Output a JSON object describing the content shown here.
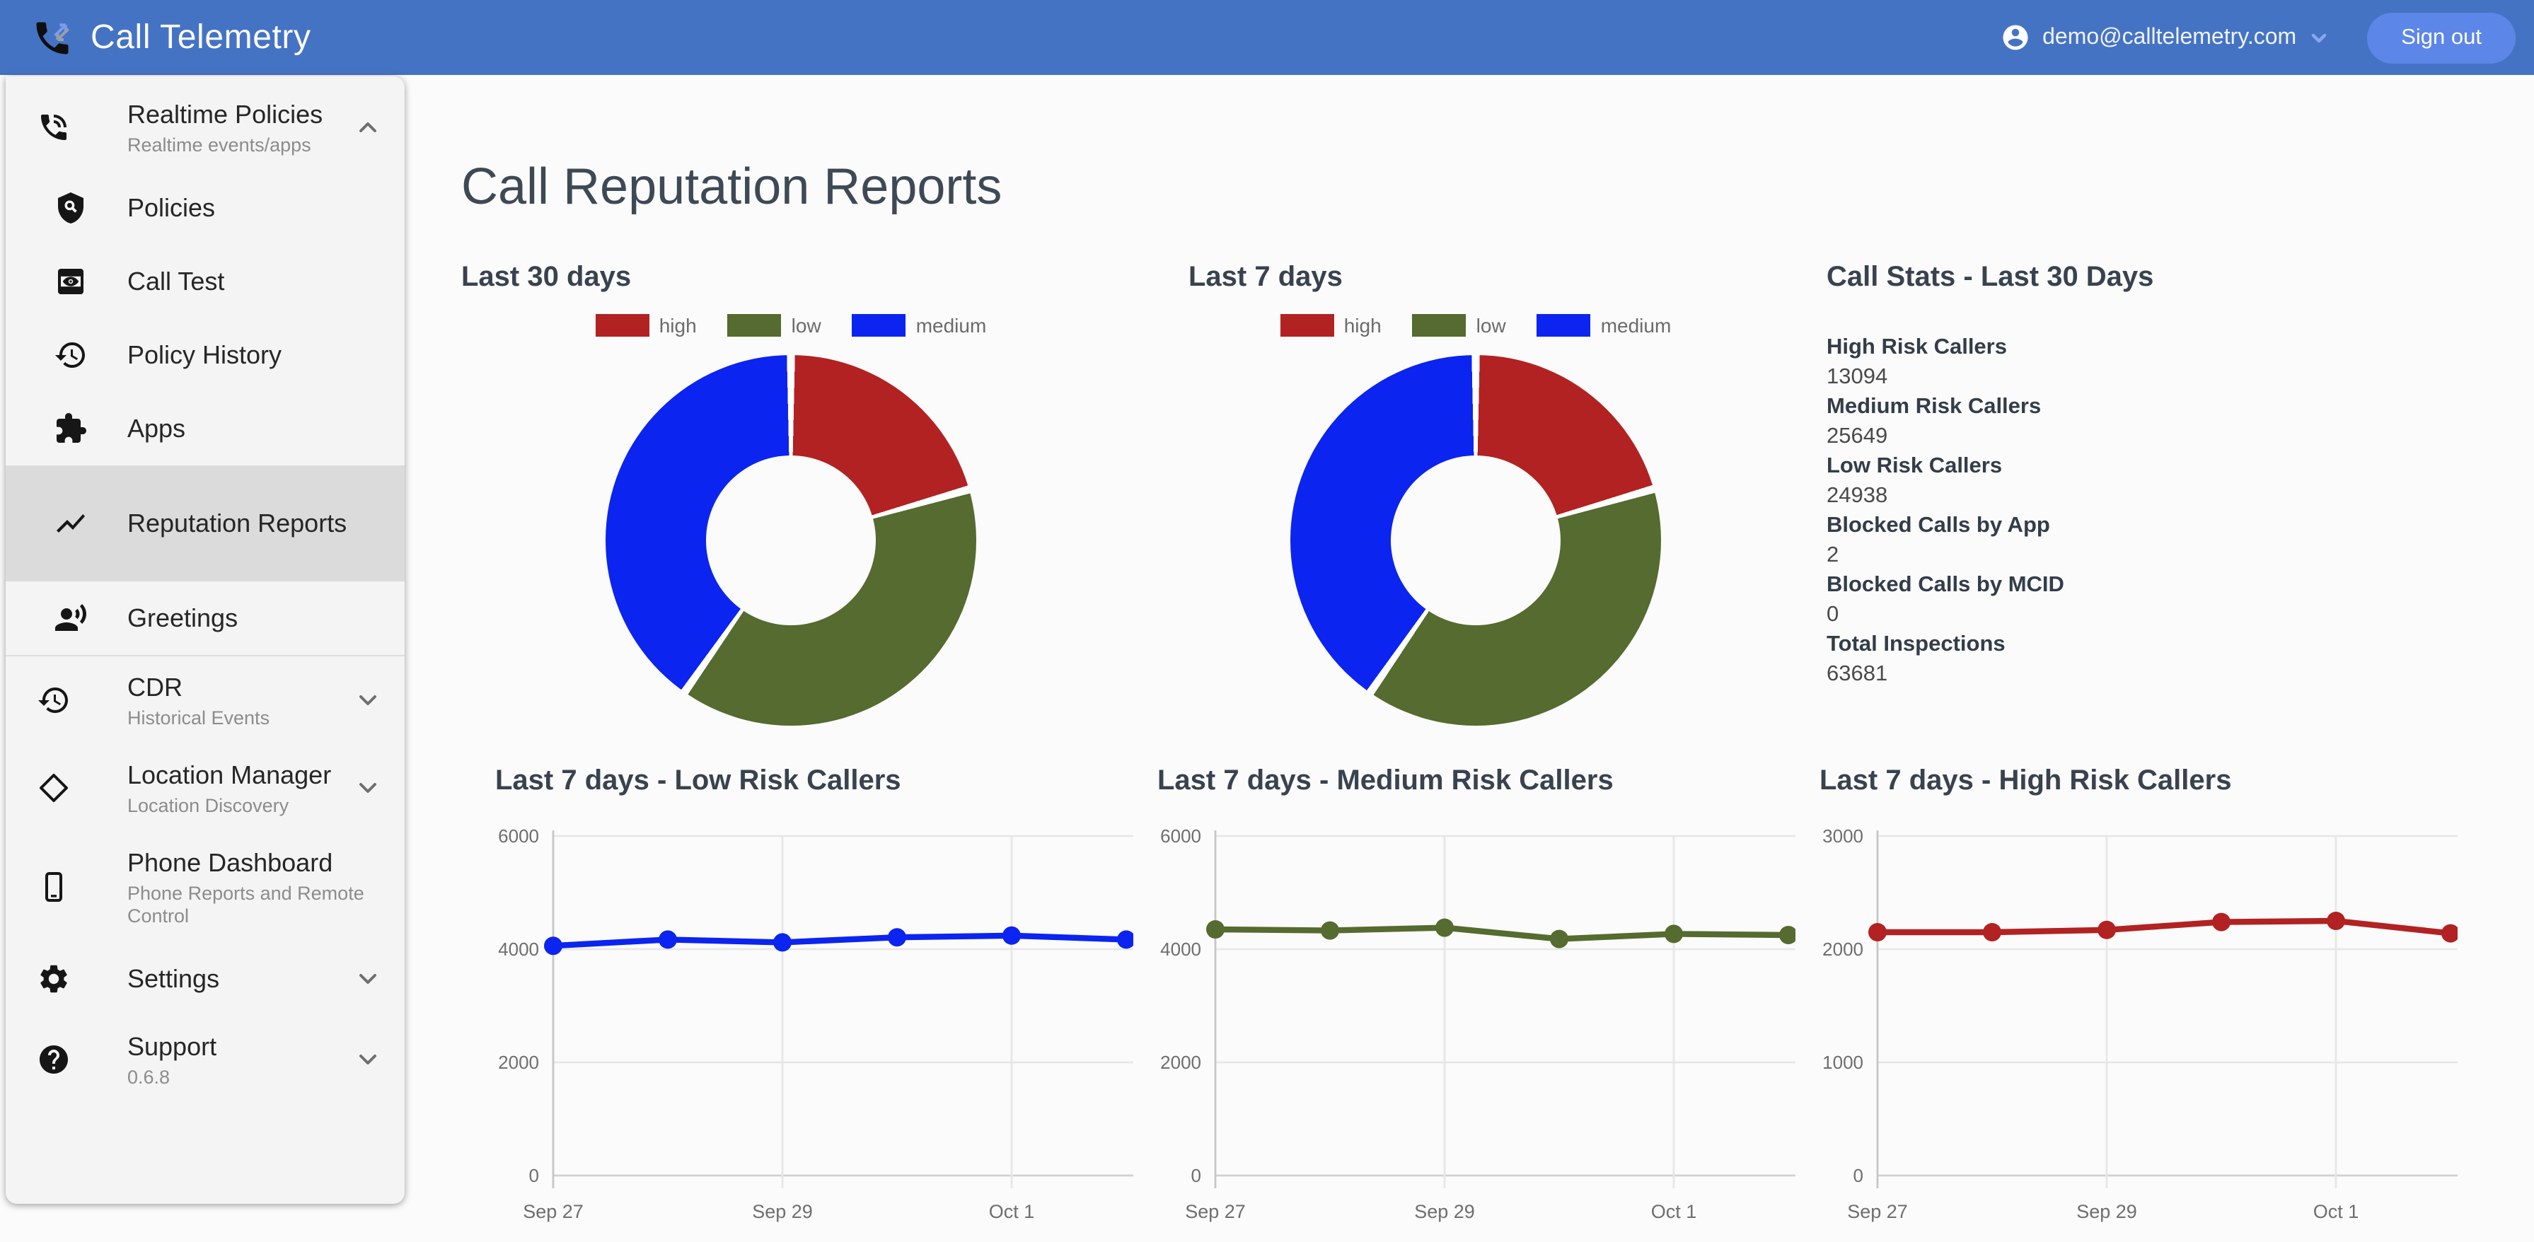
{
  "colors": {
    "header_bar": "#4573C4",
    "sign_out_button": "#5C87E8",
    "sidebar_bg": "#F4F4F4",
    "selected_item_bg": "#DBDBDB",
    "page_bg": "#FBFBFB",
    "high": "#B22222",
    "low": "#556B2F",
    "medium": "#0B24F0"
  },
  "header": {
    "app_title": "Call Telemetry",
    "user_email": "demo@calltelemetry.com",
    "sign_out_label": "Sign out"
  },
  "sidebar": {
    "items": [
      {
        "id": "realtime-policies",
        "label": "Realtime Policies",
        "sublabel": "Realtime events/apps",
        "icon": "phone-in-talk",
        "chevron": "up"
      },
      {
        "id": "policies",
        "label": "Policies",
        "icon": "policy",
        "indent": true
      },
      {
        "id": "call-test",
        "label": "Call Test",
        "icon": "screen-eye",
        "indent": true
      },
      {
        "id": "policy-history",
        "label": "Policy History",
        "icon": "history",
        "indent": true
      },
      {
        "id": "apps",
        "label": "Apps",
        "icon": "puzzle",
        "indent": true
      },
      {
        "id": "reputation-reports",
        "label": "Reputation Reports",
        "icon": "trend-line",
        "indent": true,
        "selected": true
      },
      {
        "id": "greetings",
        "label": "Greetings",
        "icon": "voice-over",
        "indent": true
      },
      {
        "id": "cdr",
        "label": "CDR",
        "sublabel": "Historical Events",
        "icon": "history",
        "chevron": "down",
        "divider_before": true
      },
      {
        "id": "location-manager",
        "label": "Location Manager",
        "sublabel": "Location Discovery",
        "icon": "location-diamond",
        "chevron": "down"
      },
      {
        "id": "phone-dashboard",
        "label": "Phone Dashboard",
        "sublabel": "Phone Reports and Remote Control",
        "icon": "smartphone"
      },
      {
        "id": "settings",
        "label": "Settings",
        "icon": "gear",
        "chevron": "down"
      },
      {
        "id": "support",
        "label": "Support",
        "sublabel": "0.6.8",
        "icon": "help-circle",
        "chevron": "down"
      }
    ]
  },
  "main": {
    "page_title": "Call Reputation Reports",
    "stats": {
      "title": "Call Stats - Last 30 Days",
      "rows": [
        {
          "label": "High Risk Callers",
          "value": "13094"
        },
        {
          "label": "Medium Risk Callers",
          "value": "25649"
        },
        {
          "label": "Low Risk Callers",
          "value": "24938"
        },
        {
          "label": "Blocked Calls by App",
          "value": "2"
        },
        {
          "label": "Blocked Calls by MCID",
          "value": "0"
        },
        {
          "label": "Total Inspections",
          "value": "63681"
        }
      ]
    }
  },
  "chart_data": [
    {
      "id": "donut-last-30-days",
      "type": "pie",
      "donut": true,
      "title": "Last 30 days",
      "legend_position": "top",
      "labels": [
        "high",
        "low",
        "medium"
      ],
      "values": [
        13094,
        24938,
        25649
      ],
      "colors": [
        "#B22222",
        "#556B2F",
        "#0B24F0"
      ]
    },
    {
      "id": "donut-last-7-days",
      "type": "pie",
      "donut": true,
      "title": "Last 7 days",
      "legend_position": "top",
      "labels": [
        "high",
        "low",
        "medium"
      ],
      "values": [
        13100,
        24970,
        25760
      ],
      "colors": [
        "#B22222",
        "#556B2F",
        "#0B24F0"
      ]
    },
    {
      "id": "line-low-risk",
      "type": "line",
      "title": "Last 7 days - Low Risk Callers",
      "x": [
        "Sep 27",
        "Sep 28",
        "Sep 29",
        "Sep 30",
        "Oct 1",
        "Oct 2"
      ],
      "x_tick_labels": [
        "Sep 27",
        "Sep 29",
        "Oct 1"
      ],
      "values": [
        4060,
        4170,
        4120,
        4210,
        4240,
        4170
      ],
      "ylim": [
        0,
        6000
      ],
      "yticks": [
        0,
        2000,
        4000,
        6000
      ],
      "color": "#0B24F0",
      "grid": true
    },
    {
      "id": "line-medium-risk",
      "type": "line",
      "title": "Last 7 days - Medium Risk Callers",
      "x": [
        "Sep 27",
        "Sep 28",
        "Sep 29",
        "Sep 30",
        "Oct 1",
        "Oct 2"
      ],
      "x_tick_labels": [
        "Sep 27",
        "Sep 29",
        "Oct 1"
      ],
      "values": [
        4350,
        4330,
        4380,
        4180,
        4270,
        4250
      ],
      "ylim": [
        0,
        6000
      ],
      "yticks": [
        0,
        2000,
        4000,
        6000
      ],
      "color": "#556B2F",
      "grid": true
    },
    {
      "id": "line-high-risk",
      "type": "line",
      "title": "Last 7 days - High Risk Callers",
      "x": [
        "Sep 27",
        "Sep 28",
        "Sep 29",
        "Sep 30",
        "Oct 1",
        "Oct 2"
      ],
      "x_tick_labels": [
        "Sep 27",
        "Sep 29",
        "Oct 1"
      ],
      "values": [
        2150,
        2150,
        2170,
        2240,
        2250,
        2140
      ],
      "ylim": [
        0,
        3000
      ],
      "yticks": [
        0,
        1000,
        2000,
        3000
      ],
      "color": "#B22222",
      "grid": true
    }
  ]
}
